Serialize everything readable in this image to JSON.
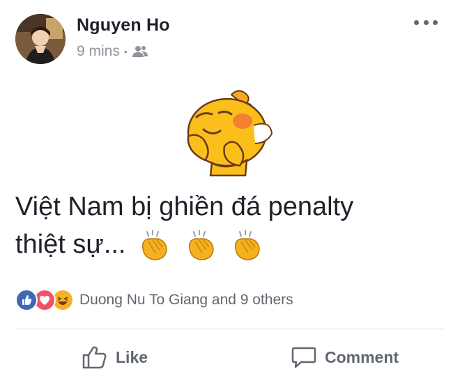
{
  "post": {
    "author": "Nguyen Ho",
    "time": "9 mins",
    "separator": "•",
    "privacy_icon": "friends-icon",
    "text_line1": "Việt Nam bị ghiền đá penalty",
    "text_line2": "thiệt sự...",
    "sticker_icon": "blushing-yellow-creature-sticker",
    "emoji_icon": "clapping-hands-emoji"
  },
  "reactions": {
    "icons": [
      "like-reaction-icon",
      "love-reaction-icon",
      "haha-reaction-icon"
    ],
    "summary": "Duong Nu To Giang and 9 others"
  },
  "actions": {
    "like_label": "Like",
    "comment_label": "Comment"
  },
  "colors": {
    "author_text": "#1d2129",
    "meta_text": "#90949c",
    "like_blue": "#4267b2",
    "love_red": "#f25268",
    "haha_yellow": "#f7b125"
  }
}
